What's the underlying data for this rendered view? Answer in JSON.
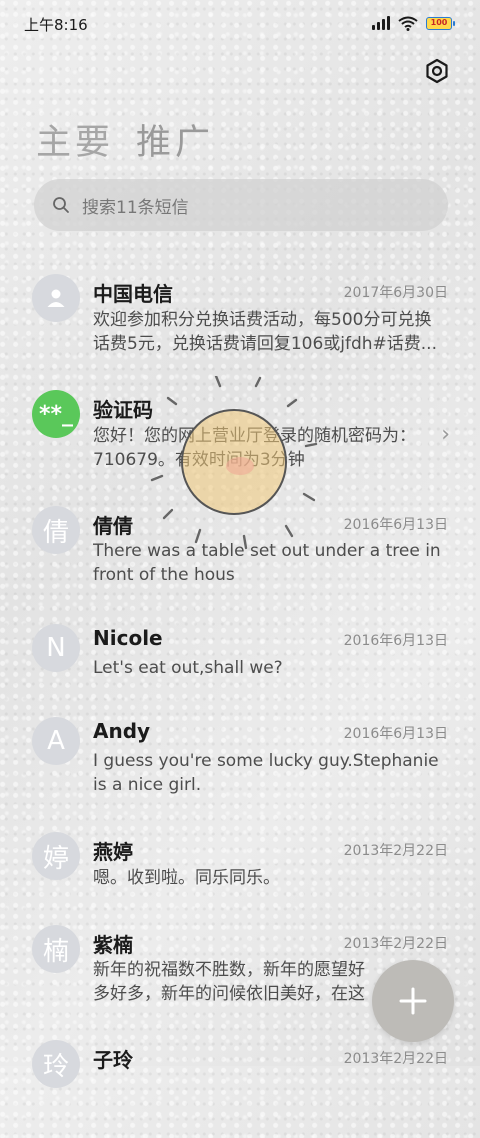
{
  "status_bar": {
    "time": "上午8:16",
    "battery_text": "100"
  },
  "tabs": [
    {
      "label": "主要"
    },
    {
      "label": "推广"
    }
  ],
  "search": {
    "placeholder": "搜索11条短信"
  },
  "conversations": [
    {
      "avatar": "",
      "avatar_icon": "person-icon",
      "sender": "中国电信",
      "date": "2017年6月30日",
      "preview": "欢迎参加积分兑换话费活动，每500分可兑换话费5元，兑换话费请回复106或jfdh#话费..."
    },
    {
      "avatar": "**_",
      "sender": "验证码",
      "date": "",
      "preview": "您好！您的网上营业厅登录的随机密码为：710679。有效时间为3分钟",
      "avatar_color": "#5ac85a"
    },
    {
      "avatar": "倩",
      "sender": "倩倩",
      "date": "2016年6月13日",
      "preview": "There was a table set out under a tree in front of the hous"
    },
    {
      "avatar": "N",
      "sender": "Nicole",
      "date": "2016年6月13日",
      "preview": "Let's eat out,shall we?"
    },
    {
      "avatar": "A",
      "sender": "Andy",
      "date": "2016年6月13日",
      "preview": "I guess you're some lucky guy.Stephanie is a nice girl."
    },
    {
      "avatar": "婷",
      "sender": "燕婷",
      "date": "2013年2月22日",
      "preview": "嗯。收到啦。同乐同乐。"
    },
    {
      "avatar": "楠",
      "sender": "紫楠",
      "date": "2013年2月22日",
      "preview": "新年的祝福数不胜数，新年的愿望好多好多，新年的问候依旧美好，在这个温馨的"
    },
    {
      "avatar": "玲",
      "sender": "子玲",
      "date": "2013年2月22日",
      "preview": ""
    }
  ],
  "colors": {
    "fab": "#bdbbb7",
    "verification_avatar": "#5ac85a",
    "avatar_default": "#d7d9de"
  }
}
